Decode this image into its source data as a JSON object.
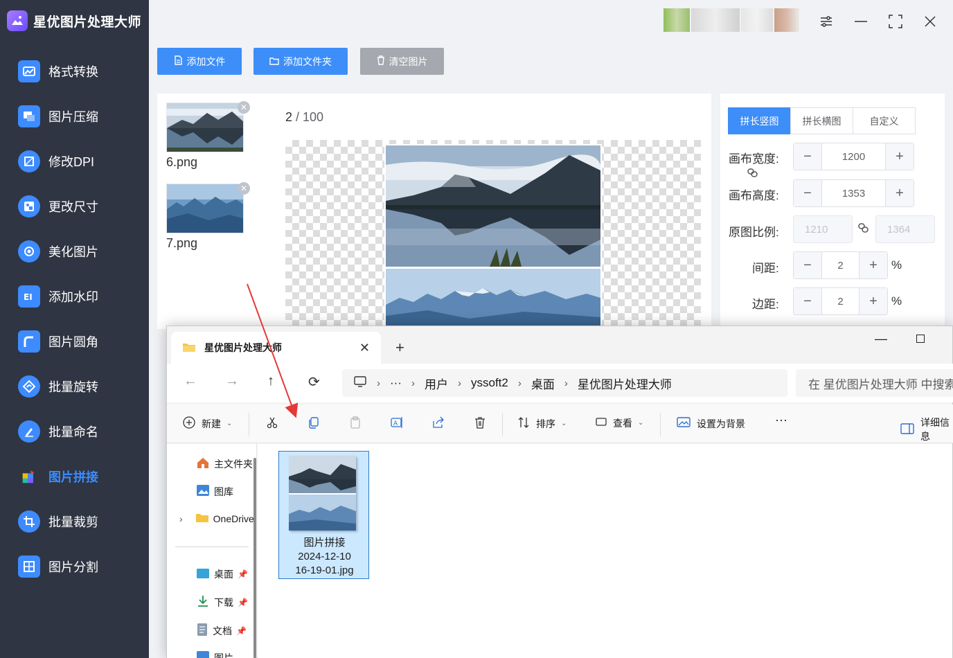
{
  "app": {
    "title": "星优图片处理大师",
    "icons": {
      "user": "blurred-user-avatar",
      "settings": "settings-icon",
      "minimize": "minimize-icon",
      "maximize": "maximize-icon",
      "close": "close-icon"
    }
  },
  "sidebar": {
    "items": [
      {
        "label": "格式转换",
        "icon": "image-convert-icon"
      },
      {
        "label": "图片压缩",
        "icon": "image-compress-icon"
      },
      {
        "label": "修改DPI",
        "icon": "dpi-icon"
      },
      {
        "label": "更改尺寸",
        "icon": "resize-icon"
      },
      {
        "label": "美化图片",
        "icon": "beautify-icon"
      },
      {
        "label": "添加水印",
        "icon": "watermark-icon"
      },
      {
        "label": "图片圆角",
        "icon": "rounded-corner-icon"
      },
      {
        "label": "批量旋转",
        "icon": "rotate-icon"
      },
      {
        "label": "批量命名",
        "icon": "rename-icon"
      },
      {
        "label": "图片拼接",
        "icon": "stitch-icon",
        "active": true
      },
      {
        "label": "批量裁剪",
        "icon": "crop-icon"
      },
      {
        "label": "图片分割",
        "icon": "split-icon"
      }
    ]
  },
  "toolbar": {
    "add_file": "添加文件",
    "add_folder": "添加文件夹",
    "clear": "清空图片"
  },
  "files": [
    {
      "name": "6.png"
    },
    {
      "name": "7.png"
    }
  ],
  "preview": {
    "current": "2",
    "separator": " / ",
    "total": "100"
  },
  "settings": {
    "tabs": [
      "拼长竖图",
      "拼长横图",
      "自定义"
    ],
    "active_tab": "拼长竖图",
    "canvas_width_label": "画布宽度:",
    "canvas_width": "1200",
    "canvas_height_label": "画布高度:",
    "canvas_height": "1353",
    "ratio_label": "原图比例:",
    "ratio_w": "1210",
    "ratio_h": "1364",
    "spacing_label": "间距:",
    "spacing": "2",
    "margin_label": "边距:",
    "margin": "2",
    "unit": "%"
  },
  "explorer": {
    "tab_title": "星优图片处理大师",
    "breadcrumb": [
      "用户",
      "yssoft2",
      "桌面",
      "星优图片处理大师"
    ],
    "breadcrumb_more": "···",
    "search_placeholder": "在 星优图片处理大师 中搜索",
    "commands": {
      "new": "新建",
      "sort": "排序",
      "view": "查看",
      "set_background": "设置为背景",
      "more": "···",
      "details": "详细信息"
    },
    "sidebar": [
      {
        "label": "主文件夹",
        "icon": "home-icon"
      },
      {
        "label": "图库",
        "icon": "gallery-icon"
      },
      {
        "label": "OneDrive",
        "icon": "folder-icon"
      },
      {
        "label": "桌面",
        "icon": "desktop-icon"
      },
      {
        "label": "下载",
        "icon": "download-icon"
      },
      {
        "label": "文档",
        "icon": "document-icon"
      },
      {
        "label": "图片",
        "icon": "pictures-icon"
      }
    ],
    "selected_file": {
      "line1": "图片拼接",
      "line2": "2024-12-10",
      "line3": "16-19-01.jpg"
    }
  },
  "colors": {
    "sidebar_bg": "#2f3542",
    "accent": "#3d8ef8",
    "active_nav": "#3b8cff",
    "arrow": "#e53935"
  }
}
